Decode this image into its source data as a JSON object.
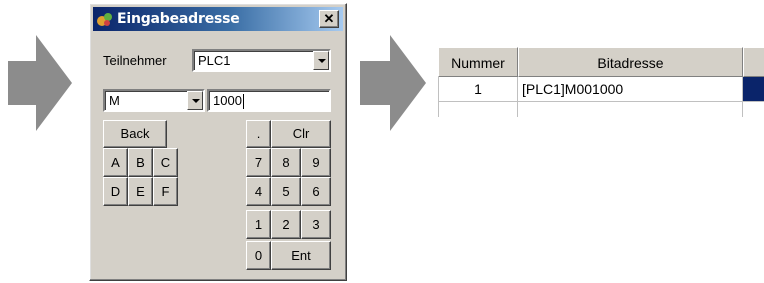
{
  "dialog": {
    "title": "Eingabeadresse",
    "close_label": "✕",
    "participant_label": "Teilnehmer",
    "participant_value": "PLC1",
    "device_type_value": "M",
    "address_value": "1000"
  },
  "keypad": {
    "back": "Back",
    "dot": ".",
    "clr": "Clr",
    "hex_keys": [
      "A",
      "B",
      "C",
      "D",
      "E",
      "F"
    ],
    "digits": [
      "7",
      "8",
      "9",
      "4",
      "5",
      "6",
      "1",
      "2",
      "3",
      "0"
    ],
    "ent": "Ent"
  },
  "table": {
    "columns": [
      "Nummer",
      "Bitadresse"
    ],
    "rows": [
      {
        "nummer": "1",
        "bitadresse": "[PLC1]M001000"
      }
    ]
  },
  "colors": {
    "titlebar_start": "#0a246a",
    "titlebar_end": "#a6caf0",
    "arrow": "#8c8c8c",
    "selection": "#0a246a"
  }
}
